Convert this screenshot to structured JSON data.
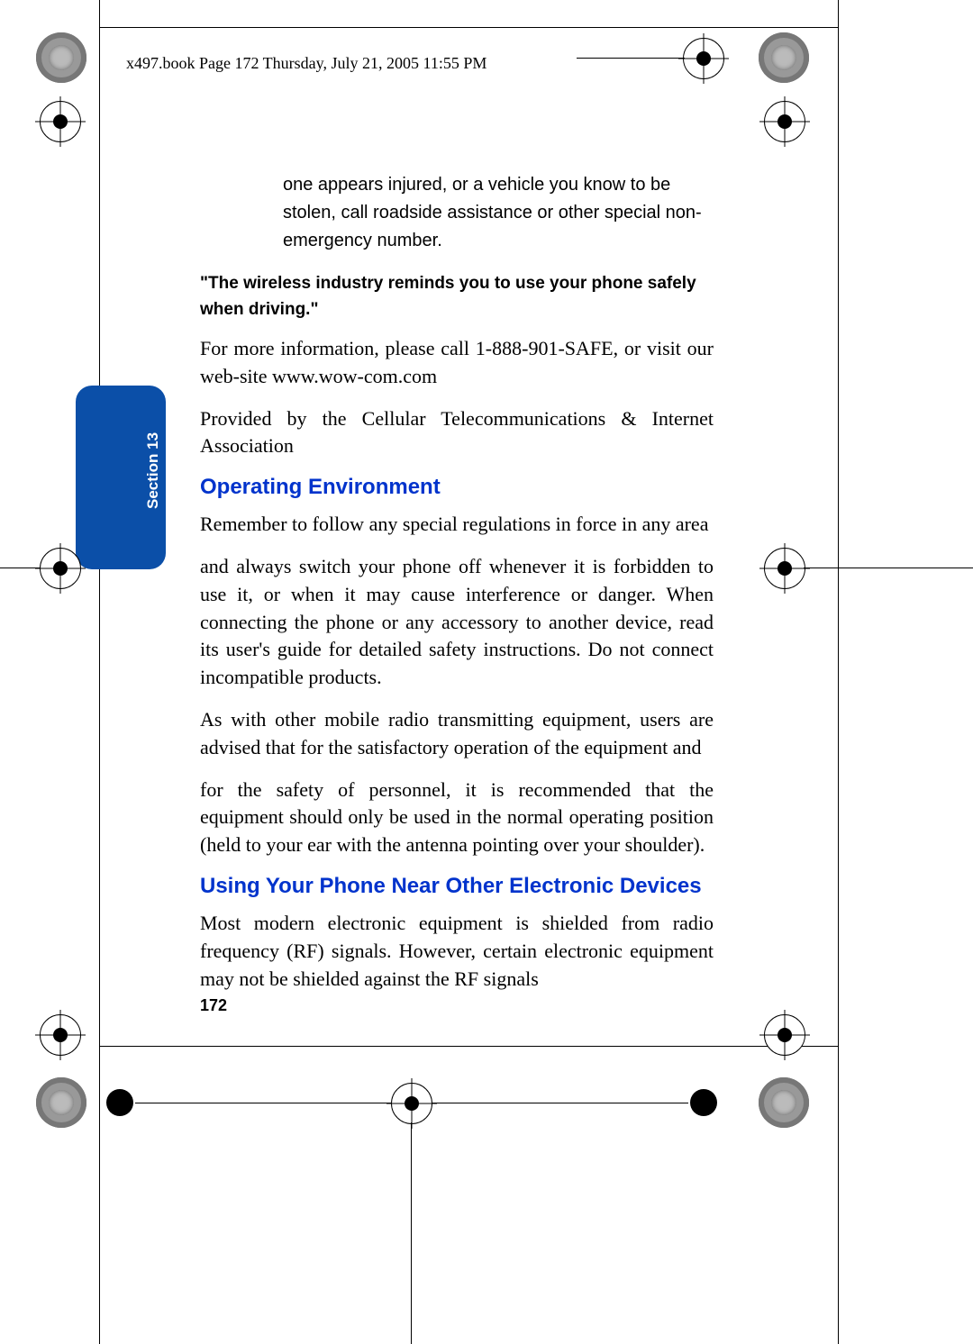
{
  "header": "x497.book  Page 172  Thursday, July 21, 2005  11:55 PM",
  "section_label": "Section 13",
  "page_number": "172",
  "paragraphs": {
    "intro_indent": "one appears injured, or a vehicle you know to be stolen, call roadside assistance or other special non-emergency number.",
    "reminder_bold": "\"The wireless industry reminds you to use your phone safely when driving.\"",
    "more_info": "For more information, please call 1-888-901-SAFE, or visit our web-site www.wow-com.com",
    "provided_by": "Provided by the Cellular Telecommunications & Internet Association",
    "oe_heading": "Operating Environment",
    "oe_p1": "Remember to follow any special regulations in force in any area",
    "oe_p2": "and always switch your phone off whenever it is forbidden to use it, or when it may cause interference or danger. When connecting the phone or any accessory to another device, read its user's guide for detailed safety instructions. Do not connect incompatible products.",
    "oe_p3": "As with other mobile radio transmitting equipment, users are advised that for the satisfactory operation of the equipment and",
    "oe_p4": "for the safety of personnel, it is recommended that the equipment should only be used in the normal operating position (held to your ear with the antenna pointing over your shoulder).",
    "ed_heading": "Using Your Phone Near Other Electronic Devices",
    "ed_p1": "Most modern electronic equipment is shielded from radio frequency (RF) signals. However, certain electronic equipment may not be shielded against the RF signals"
  }
}
